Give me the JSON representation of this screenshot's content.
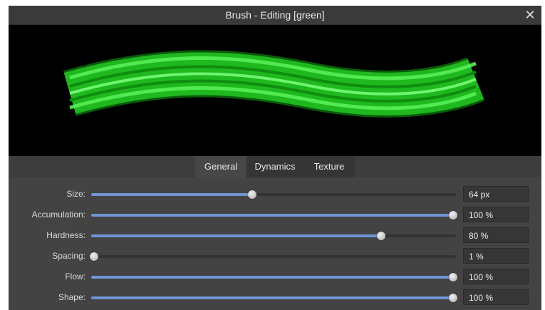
{
  "window": {
    "title": "Brush - Editing [green]",
    "close_glyph": "✕"
  },
  "tabs": [
    {
      "label": "General",
      "active": true
    },
    {
      "label": "Dynamics",
      "active": false
    },
    {
      "label": "Texture",
      "active": false
    }
  ],
  "rows": [
    {
      "label": "Size:",
      "value": "64 px",
      "level": 0.44
    },
    {
      "label": "Accumulation:",
      "value": "100 %",
      "level": 1.0
    },
    {
      "label": "Hardness:",
      "value": "80 %",
      "level": 0.8
    },
    {
      "label": "Spacing:",
      "value": "1 %",
      "level": 0.0
    },
    {
      "label": "Flow:",
      "value": "100 %",
      "level": 1.0
    },
    {
      "label": "Shape:",
      "value": "100 %",
      "level": 1.0
    }
  ],
  "colors": {
    "stroke": "#22dd22",
    "slider_fill": "#6f95d3"
  },
  "icons": {
    "close": "close-icon"
  }
}
